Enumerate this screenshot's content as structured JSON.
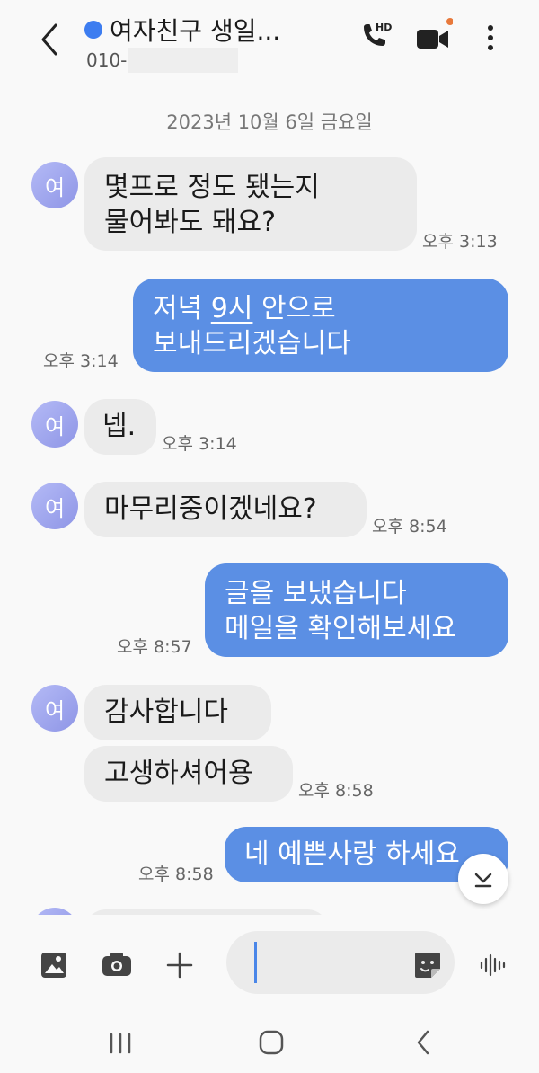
{
  "header": {
    "back_icon": "chevron-left-icon",
    "title": "여자친구 생일...",
    "subtitle": "010-4",
    "hd_label": "HD",
    "call_icon": "phone-hd-icon",
    "video_icon": "video-call-icon",
    "menu_icon": "more-vertical-icon",
    "accent": "#3d7df0",
    "notification_dot_color": "#e8793b"
  },
  "conversation": {
    "date": "2023년 10월 6일 금요일",
    "avatar_initial": "여",
    "messages": [
      {
        "dir": "in",
        "lines": [
          "몇프로 정도 됐는지",
          "물어봐도 돼요?"
        ],
        "time": "오후 3:13"
      },
      {
        "dir": "out",
        "lines": [
          "저녁 9시 안으로",
          "보내드리겠습니다"
        ],
        "underlined": "9시",
        "time": "오후 3:14"
      },
      {
        "dir": "in",
        "lines": [
          "넵."
        ],
        "time": "오후 3:14"
      },
      {
        "dir": "in",
        "lines": [
          "마무리중이겠네요?"
        ],
        "time": "오후 8:54"
      },
      {
        "dir": "out",
        "lines": [
          "글을 보냈습니다",
          "메일을 확인해보세요"
        ],
        "time": "오후 8:57"
      },
      {
        "dir": "in",
        "lines": [
          "감사합니다"
        ]
      },
      {
        "dir": "in",
        "lines": [
          "고생하셔어용"
        ],
        "time": "오후 8:58"
      },
      {
        "dir": "out",
        "lines": [
          "네 예쁜사랑 하세요"
        ],
        "time": "오후 8:58"
      }
    ]
  },
  "m2": {
    "a": "저녁 ",
    "u": "9시",
    "b": " 안으로"
  },
  "composer": {
    "gallery_icon": "gallery-icon",
    "camera_icon": "camera-icon",
    "add_icon": "plus-icon",
    "sticker_icon": "sticker-icon",
    "voice_icon": "voice-wave-icon",
    "input_value": ""
  },
  "scroll_down_icon": "scroll-to-bottom-icon",
  "nav": {
    "recents_icon": "recents-icon",
    "home_icon": "home-icon",
    "back_icon": "nav-back-icon"
  },
  "colors": {
    "outgoing_bubble": "#5b8fe4",
    "incoming_bubble": "#ebebeb",
    "avatar": "#9ea4ee"
  }
}
